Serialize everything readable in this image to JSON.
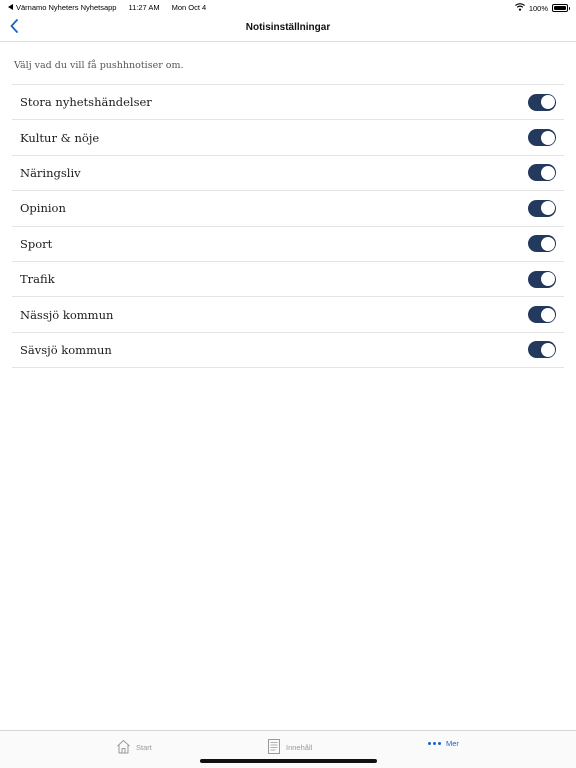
{
  "colors": {
    "accent": "#1a66c4",
    "toggle_on": "#23395d",
    "tab_inactive": "#9a9a9a"
  },
  "status_bar": {
    "back_app": "Värnamo Nyheters Nyhetsapp",
    "time": "11:27 AM",
    "date": "Mon Oct 4",
    "battery": "100%"
  },
  "nav": {
    "back_icon": "chevron-left-icon",
    "title": "Notisinställningar"
  },
  "intro_text": "Välj vad du vill få pushhnotiser om.",
  "settings": [
    {
      "label": "Stora nyhetshändelser",
      "enabled": true
    },
    {
      "label": "Kultur & nöje",
      "enabled": true
    },
    {
      "label": "Näringsliv",
      "enabled": true
    },
    {
      "label": "Opinion",
      "enabled": true
    },
    {
      "label": "Sport",
      "enabled": true
    },
    {
      "label": "Trafik",
      "enabled": true
    },
    {
      "label": "Nässjö kommun",
      "enabled": true
    },
    {
      "label": "Sävsjö kommun",
      "enabled": true
    }
  ],
  "tabs": [
    {
      "label": "Start",
      "icon": "home-icon",
      "active": false
    },
    {
      "label": "Innehåll",
      "icon": "newspaper-icon",
      "active": false
    },
    {
      "label": "Mer",
      "icon": "more-dots-icon",
      "active": true
    }
  ]
}
